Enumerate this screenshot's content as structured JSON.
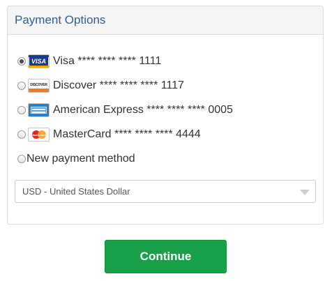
{
  "panel": {
    "title": "Payment Options"
  },
  "payment_methods": [
    {
      "card_brand": "Visa",
      "card_icon": "visa-card-icon",
      "label": "Visa **** **** **** 1111",
      "selected": true
    },
    {
      "card_brand": "Discover",
      "card_icon": "discover-card-icon",
      "label": "Discover **** **** **** 1117",
      "selected": false
    },
    {
      "card_brand": "American Express",
      "card_icon": "amex-card-icon",
      "label": "American Express **** **** **** 0005",
      "selected": false
    },
    {
      "card_brand": "MasterCard",
      "card_icon": "mastercard-card-icon",
      "label": "MasterCard **** **** **** 4444",
      "selected": false
    },
    {
      "card_brand": "",
      "card_icon": "",
      "label": "New payment method",
      "selected": false
    }
  ],
  "card_logos": {
    "visa": "VISA",
    "discover": "DISCOVER",
    "mastercard": "MasterCard"
  },
  "currency_select": {
    "value": "USD - United States Dollar"
  },
  "continue_button": {
    "label": "Continue"
  },
  "colors": {
    "title": "#2e5f8f",
    "continue_bg": "#19a14a",
    "header_bg": "#f5f5f5",
    "border": "#dcdcdc"
  }
}
